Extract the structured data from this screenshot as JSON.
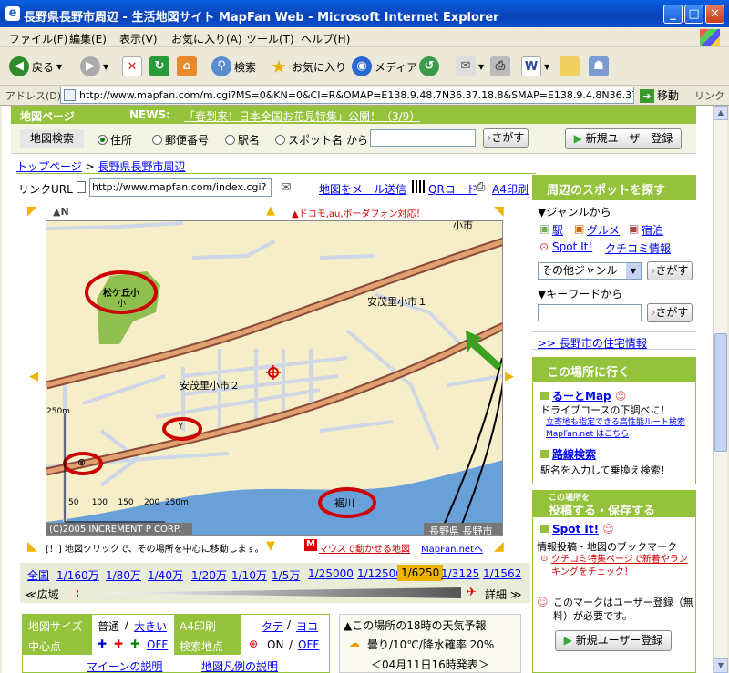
{
  "window": {
    "title": "長野県長野市周辺 - 生活地図サイト MapFan Web - Microsoft Internet Explorer"
  },
  "menu": [
    "ファイル(F)",
    "編集(E)",
    "表示(V)",
    "お気に入り(A)",
    "ツール(T)",
    "ヘルプ(H)"
  ],
  "toolbar": {
    "back": "戻る",
    "search": "検索",
    "favorites": "お気に入り",
    "media": "メディア"
  },
  "address": {
    "label": "アドレス(D)",
    "url": "http://www.mapfan.com/m.cgi?MS=0&KN=0&CI=R&OMAP=E138.9.48.7N36.37.18.8&SMAP=E138.9.4.8N36.37.18.8&SP=1&",
    "go": "移動",
    "links": "リンク"
  },
  "header": {
    "page_label": "地図ページ",
    "news_label": "NEWS:",
    "news_link": "「春到来！日本全国お花見特集」公開！（3/9）"
  },
  "search": {
    "label": "地図検索",
    "options": [
      "住所",
      "郵便番号",
      "駅名",
      "スポット名"
    ],
    "from": "から",
    "button": "さがす",
    "register": "新規ユーザー登録"
  },
  "breadcrumb": {
    "top": "トップページ",
    "sep": ">",
    "current": "長野県長野市周辺"
  },
  "linkurl": {
    "label": "リンクURL",
    "value": "http://www.mapfan.com/index.cgi?",
    "mail": "地図をメール送信",
    "qr": "QRコード",
    "print": "A4印刷"
  },
  "map": {
    "north": "▲N",
    "mobile_note": "▲ドコモ,au,ボーダフォン対応！",
    "labels": {
      "school": "松ケ丘小",
      "school_sub": "小",
      "area1": "安茂里小市１",
      "area2": "安茂里小市２",
      "city": "小市",
      "river": "裾川"
    },
    "scale_top": "250m",
    "scale_ticks": [
      "50",
      "100",
      "150",
      "200",
      "250m"
    ],
    "copyright": "(C)2005 INCREMENT P CORP.",
    "location": "長野県 長野市",
    "hint": "[！] 地図クリックで、その場所を中心に移動します。",
    "mousemap": "マウスで動かせる地図",
    "mousemap_link": "MapFan.netへ"
  },
  "scales": [
    "全国",
    "1/160万",
    "1/80万",
    "1/40万",
    "1/20万",
    "1/10万",
    "1/5万",
    "1/25000",
    "1/12500",
    "1/6250",
    "1/3125",
    "1/1562"
  ],
  "scale_selected": "1/6250",
  "zoom": {
    "wide": "≪広域",
    "detail": "詳細 ≫"
  },
  "options": {
    "map_size": "地図サイズ",
    "size_normal": "普通",
    "size_large": "大きい",
    "a4": "A4印刷",
    "a4_portrait": "タテ",
    "a4_landscape": "ヨコ",
    "center": "中心点",
    "off": "OFF",
    "search_point": "検索地点",
    "on": "ON",
    "on_off_sep": "/",
    "footer1": "マイーンの説明",
    "footer2": "地図凡例の説明"
  },
  "weather": {
    "title": "▲この場所の18時の天気予報",
    "forecast": "曇り/10℃/降水確率 20%",
    "date": "＜04月11日16時発表＞"
  },
  "sidebar": {
    "spots_title": "周辺のスポットを探す",
    "genre_label": "▼ジャンルから",
    "station": "駅",
    "gourmet": "グルメ",
    "lodging": "宿泊",
    "spot_it": "Spot It!",
    "kuchikomi": "クチコミ情報",
    "genre_select": "その他ジャンル",
    "search_btn": "さがす",
    "keyword_label": "▼キーワードから",
    "housing": ">> 長野市の住宅情報",
    "go_title": "この場所に行く",
    "route_map": "るーとMap",
    "route_desc": "ドライブコースの下調べに！",
    "route_link": "立寄地も指定できる高性能ルート検索 MapFan.net はこちら",
    "transit": "路線検索",
    "transit_desc": "駅名を入力して乗換え検索！",
    "post_small": "この場所を",
    "post_title": "投稿する・保存する",
    "spot_it2": "Spot It!",
    "post_desc": "情報投稿・地図のブックマーク",
    "post_link": "クチコミ特集ページで新着やランキングをチェック！",
    "notice": "このマークはユーザー登録（無料）が必要です。",
    "register": "新規ユーザー登録"
  }
}
